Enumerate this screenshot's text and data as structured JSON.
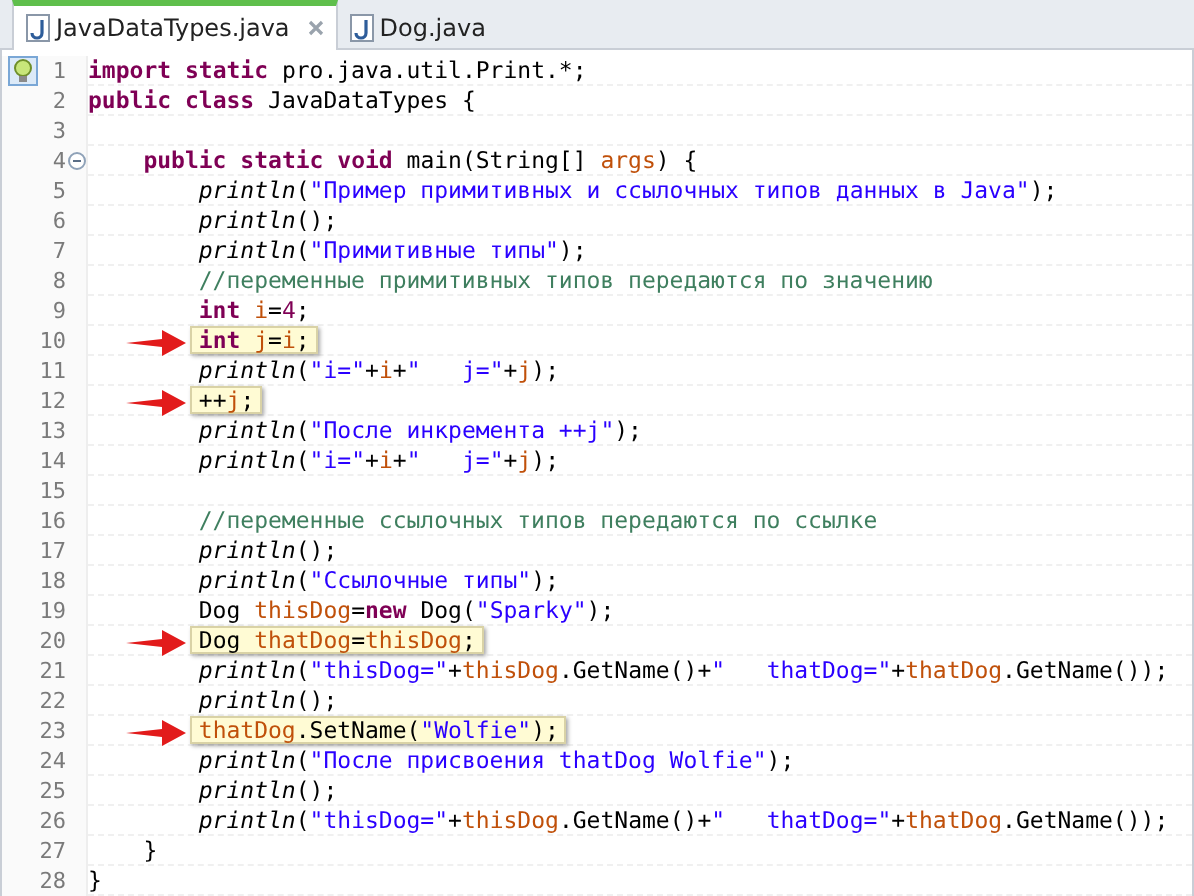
{
  "tabs": [
    {
      "label": "JavaDataTypes.java",
      "selected": true
    },
    {
      "label": "Dog.java",
      "selected": false
    }
  ],
  "lines": [
    {
      "number": "1",
      "quick_fix": true,
      "tokens": [
        {
          "kind": "kw",
          "text": "import"
        },
        {
          "kind": "kw",
          "text": " static"
        },
        {
          "kind": "plain",
          "text": " pro.java.util.Print.*;"
        }
      ]
    },
    {
      "number": "2",
      "tokens": [
        {
          "kind": "kw",
          "text": "public"
        },
        {
          "kind": "kw",
          "text": " class"
        },
        {
          "kind": "plain",
          "text": " JavaDataTypes {"
        }
      ]
    },
    {
      "number": "3"
    },
    {
      "number": "4",
      "fold": true,
      "tokens": [
        {
          "kind": "kw",
          "text": "    public"
        },
        {
          "kind": "kw",
          "text": " static"
        },
        {
          "kind": "kw",
          "text": " void"
        },
        {
          "kind": "plain",
          "text": " main(String[] "
        },
        {
          "kind": "var",
          "text": "args"
        },
        {
          "kind": "plain",
          "text": ") {"
        }
      ]
    },
    {
      "number": "5",
      "tokens": [
        {
          "kind": "call",
          "text": "        println"
        },
        {
          "kind": "plain",
          "text": "("
        },
        {
          "kind": "str",
          "text": "\"Пример примитивных и ссылочных типов данных в Java\""
        },
        {
          "kind": "plain",
          "text": ");"
        }
      ]
    },
    {
      "number": "6",
      "tokens": [
        {
          "kind": "call",
          "text": "        println"
        },
        {
          "kind": "plain",
          "text": "();"
        }
      ]
    },
    {
      "number": "7",
      "tokens": [
        {
          "kind": "call",
          "text": "        println"
        },
        {
          "kind": "plain",
          "text": "("
        },
        {
          "kind": "str",
          "text": "\"Примитивные типы\""
        },
        {
          "kind": "plain",
          "text": ");"
        }
      ]
    },
    {
      "number": "8",
      "tokens": [
        {
          "kind": "comment",
          "text": "        //переменные примитивных типов передаются по значению"
        }
      ]
    },
    {
      "number": "9",
      "tokens": [
        {
          "kind": "kw",
          "text": "        int"
        },
        {
          "kind": "var",
          "text": " i"
        },
        {
          "kind": "plain",
          "text": "="
        },
        {
          "kind": "num",
          "text": "4"
        },
        {
          "kind": "plain",
          "text": ";"
        }
      ]
    },
    {
      "number": "10",
      "marked": true,
      "tokens": [
        {
          "kind": "kw",
          "text": "        int"
        },
        {
          "kind": "var",
          "text": " j"
        },
        {
          "kind": "plain",
          "text": "="
        },
        {
          "kind": "var",
          "text": "i"
        },
        {
          "kind": "plain",
          "text": ";"
        }
      ]
    },
    {
      "number": "11",
      "tokens": [
        {
          "kind": "call",
          "text": "        println"
        },
        {
          "kind": "plain",
          "text": "("
        },
        {
          "kind": "str",
          "text": "\"i=\""
        },
        {
          "kind": "plain",
          "text": "+"
        },
        {
          "kind": "var",
          "text": "i"
        },
        {
          "kind": "plain",
          "text": "+"
        },
        {
          "kind": "str",
          "text": "\"   j=\""
        },
        {
          "kind": "plain",
          "text": "+"
        },
        {
          "kind": "var",
          "text": "j"
        },
        {
          "kind": "plain",
          "text": ");"
        }
      ]
    },
    {
      "number": "12",
      "marked": true,
      "tokens": [
        {
          "kind": "plain",
          "text": "        ++"
        },
        {
          "kind": "var",
          "text": "j"
        },
        {
          "kind": "plain",
          "text": ";"
        }
      ]
    },
    {
      "number": "13",
      "tokens": [
        {
          "kind": "call",
          "text": "        println"
        },
        {
          "kind": "plain",
          "text": "("
        },
        {
          "kind": "str",
          "text": "\"После инкремента ++j\""
        },
        {
          "kind": "plain",
          "text": ");"
        }
      ]
    },
    {
      "number": "14",
      "tokens": [
        {
          "kind": "call",
          "text": "        println"
        },
        {
          "kind": "plain",
          "text": "("
        },
        {
          "kind": "str",
          "text": "\"i=\""
        },
        {
          "kind": "plain",
          "text": "+"
        },
        {
          "kind": "var",
          "text": "i"
        },
        {
          "kind": "plain",
          "text": "+"
        },
        {
          "kind": "str",
          "text": "\"   j=\""
        },
        {
          "kind": "plain",
          "text": "+"
        },
        {
          "kind": "var",
          "text": "j"
        },
        {
          "kind": "plain",
          "text": ");"
        }
      ]
    },
    {
      "number": "15"
    },
    {
      "number": "16",
      "tokens": [
        {
          "kind": "comment",
          "text": "        //переменные ссылочных типов передаются по ссылке"
        }
      ]
    },
    {
      "number": "17",
      "tokens": [
        {
          "kind": "call",
          "text": "        println"
        },
        {
          "kind": "plain",
          "text": "();"
        }
      ]
    },
    {
      "number": "18",
      "tokens": [
        {
          "kind": "call",
          "text": "        println"
        },
        {
          "kind": "plain",
          "text": "("
        },
        {
          "kind": "str",
          "text": "\"Ссылочные типы\""
        },
        {
          "kind": "plain",
          "text": ");"
        }
      ]
    },
    {
      "number": "19",
      "tokens": [
        {
          "kind": "plain",
          "text": "        Dog "
        },
        {
          "kind": "var",
          "text": "thisDog"
        },
        {
          "kind": "plain",
          "text": "="
        },
        {
          "kind": "kw",
          "text": "new"
        },
        {
          "kind": "plain",
          "text": " Dog("
        },
        {
          "kind": "str",
          "text": "\"Sparky\""
        },
        {
          "kind": "plain",
          "text": ");"
        }
      ]
    },
    {
      "number": "20",
      "marked": true,
      "tokens": [
        {
          "kind": "plain",
          "text": "        Dog "
        },
        {
          "kind": "var",
          "text": "thatDog"
        },
        {
          "kind": "plain",
          "text": "="
        },
        {
          "kind": "var",
          "text": "thisDog"
        },
        {
          "kind": "plain",
          "text": ";"
        }
      ]
    },
    {
      "number": "21",
      "tokens": [
        {
          "kind": "call",
          "text": "        println"
        },
        {
          "kind": "plain",
          "text": "("
        },
        {
          "kind": "str",
          "text": "\"thisDog=\""
        },
        {
          "kind": "plain",
          "text": "+"
        },
        {
          "kind": "var",
          "text": "thisDog"
        },
        {
          "kind": "plain",
          "text": ".GetName()+"
        },
        {
          "kind": "str",
          "text": "\"   thatDog=\""
        },
        {
          "kind": "plain",
          "text": "+"
        },
        {
          "kind": "var",
          "text": "thatDog"
        },
        {
          "kind": "plain",
          "text": ".GetName());"
        }
      ]
    },
    {
      "number": "22",
      "tokens": [
        {
          "kind": "call",
          "text": "        println"
        },
        {
          "kind": "plain",
          "text": "();"
        }
      ]
    },
    {
      "number": "23",
      "marked": true,
      "tokens": [
        {
          "kind": "var",
          "text": "        thatDog"
        },
        {
          "kind": "plain",
          "text": ".SetName("
        },
        {
          "kind": "str",
          "text": "\"Wolfie\""
        },
        {
          "kind": "plain",
          "text": ");"
        }
      ]
    },
    {
      "number": "24",
      "tokens": [
        {
          "kind": "call",
          "text": "        println"
        },
        {
          "kind": "plain",
          "text": "("
        },
        {
          "kind": "str",
          "text": "\"После присвоения thatDog Wolfie\""
        },
        {
          "kind": "plain",
          "text": ");"
        }
      ]
    },
    {
      "number": "25",
      "tokens": [
        {
          "kind": "call",
          "text": "        println"
        },
        {
          "kind": "plain",
          "text": "();"
        }
      ]
    },
    {
      "number": "26",
      "tokens": [
        {
          "kind": "call",
          "text": "        println"
        },
        {
          "kind": "plain",
          "text": "("
        },
        {
          "kind": "str",
          "text": "\"thisDog=\""
        },
        {
          "kind": "plain",
          "text": "+"
        },
        {
          "kind": "var",
          "text": "thisDog"
        },
        {
          "kind": "plain",
          "text": ".GetName()+"
        },
        {
          "kind": "str",
          "text": "\"   thatDog=\""
        },
        {
          "kind": "plain",
          "text": "+"
        },
        {
          "kind": "var",
          "text": "thatDog"
        },
        {
          "kind": "plain",
          "text": ".GetName());"
        }
      ]
    },
    {
      "number": "27",
      "tokens": [
        {
          "kind": "plain",
          "text": "    }"
        }
      ]
    },
    {
      "number": "28",
      "tokens": [
        {
          "kind": "plain",
          "text": "}"
        }
      ]
    }
  ]
}
